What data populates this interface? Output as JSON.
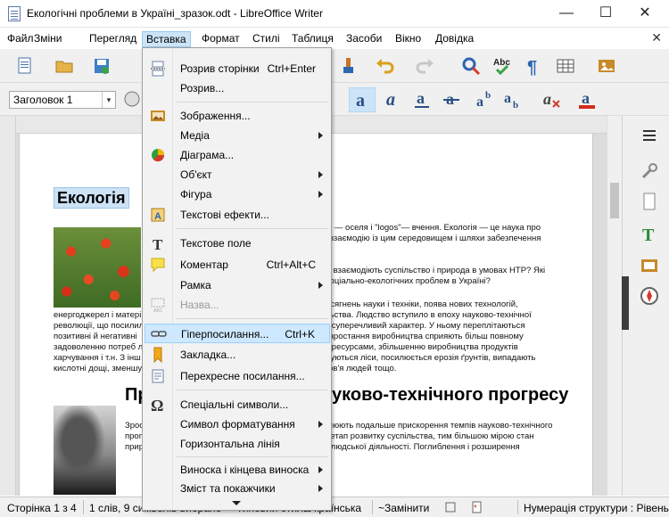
{
  "window": {
    "title": "Екологічні проблеми в Україні_зразок.odt - LibreOffice Writer",
    "minimize": "—",
    "maximize": "☐",
    "close": "✕"
  },
  "menubar": {
    "items": [
      "Файл",
      "Зміни",
      "Перегляд",
      "Вставка",
      "Формат",
      "Стилі",
      "Таблиця",
      "Засоби",
      "Вікно",
      "Довідка"
    ],
    "active": "Вставка",
    "close_glyph": "✕"
  },
  "toolbar": {
    "paragraph_style": "Заголовок 1",
    "dropdown_glyph": "▾"
  },
  "document": {
    "heading1": "Екологія",
    "lines1": [
      "ikos\" — оселя і \"logos\"— вчення. Екологія — це наука про",
      "у, її взаємодію із цим середовищем і шляхи забезпечення"
    ],
    "lines2": [
      "? Як взаємодіють суспільство і природа в умовах НТР? Які",
      "их соціально-екологічних проблем в Україні?"
    ],
    "line_a": "х досягнень науки і техніки, поява нових технологій,",
    "lines3": [
      "енергоджерел і матері",
      "революції, що посилил",
      "позитивні й негативні",
      "задоволенню потреб л",
      "харчування і т.н. З інш",
      "кислотні дощі, зменшу"
    ],
    "lines3_right": [
      "спільства. Людство вступило в епоху науково-технічної",
      "мае суперечливий характер. У ньому переплітаються",
      "ції і зростання виробництва сприяють більш повному",
      "ими ресурсами, збільшенню виробництва продуктів",
      "нищуються ліси, посилюється ерозія ґрунтів, випадають",
      "доров'я людей тощо."
    ],
    "heading2_start": "Пр",
    "heading2_end": "уково-технічного прогресу",
    "lines4": [
      "Зрост",
      "прогр",
      "приро"
    ],
    "lines4_right": [
      "ровлюють подальше прискорення темпів науково-технічного",
      "ний етап розвитку суспільства, тим більшою мірою стан",
      "ість людської діяльності. Поглиблення і розширення"
    ]
  },
  "insert_menu": {
    "items": [
      {
        "label": "Розрив сторінки",
        "shortcut": "Ctrl+Enter",
        "icon": "page-break-icon"
      },
      {
        "label": "Розрив...",
        "icon": ""
      },
      {
        "label": "Зображення...",
        "icon": "image-icon"
      },
      {
        "label": "Медіа",
        "submenu": true
      },
      {
        "label": "Діаграма...",
        "icon": "chart-icon"
      },
      {
        "label": "Об'єкт",
        "submenu": true
      },
      {
        "label": "Фігура",
        "submenu": true
      },
      {
        "label": "Текстові ефекти...",
        "icon": "fontwork-icon"
      },
      {
        "label": "Текстове поле",
        "icon": "text-box-icon"
      },
      {
        "label": "Коментар",
        "shortcut": "Ctrl+Alt+C",
        "icon": "comment-icon"
      },
      {
        "label": "Рамка",
        "submenu": true
      },
      {
        "label": "Назва...",
        "disabled": true,
        "icon": "caption-icon"
      },
      {
        "label": "Гіперпосилання...",
        "shortcut": "Ctrl+K",
        "highlighted": true,
        "icon": "hyperlink-icon"
      },
      {
        "label": "Закладка...",
        "icon": "bookmark-icon"
      },
      {
        "label": "Перехресне посилання...",
        "icon": "cross-reference-icon"
      },
      {
        "label": "Спеціальні символи...",
        "icon": "omega-icon"
      },
      {
        "label": "Символ форматування",
        "submenu": true
      },
      {
        "label": "Горизонтальна лінія"
      },
      {
        "label": "Виноска і кінцева виноска",
        "submenu": true
      },
      {
        "label": "Зміст та покажчики",
        "submenu": true
      }
    ]
  },
  "statusbar": {
    "page": "Сторінка 1 з 4",
    "words": "1 слів, 9 символів вибрано",
    "page_style": "Типовий стиль",
    "language": "Українська",
    "insert_mode": "~Замінити",
    "outline": "Нумерація структури : Рівень"
  },
  "colors": {
    "menu_highlight": "#cde8ff",
    "active_menu": "#cce4f7",
    "selection": "#cde2f5"
  }
}
